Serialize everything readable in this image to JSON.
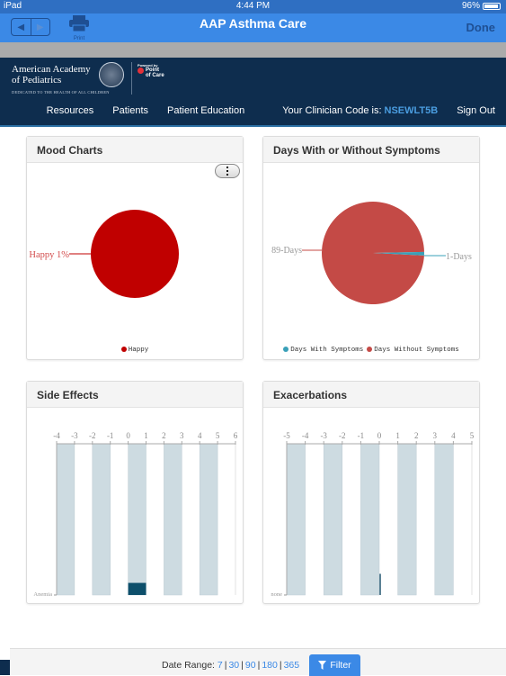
{
  "status_bar": {
    "device": "iPad",
    "time": "4:44 PM",
    "battery": "96%",
    "battery_level": 0.96
  },
  "nav_bar": {
    "title": "AAP Asthma Care",
    "print_label": "Print",
    "done_label": "Done"
  },
  "site_header": {
    "org_name_line1": "American Academy",
    "org_name_line2": "of Pediatrics",
    "tagline": "DEDICATED TO THE HEALTH OF ALL CHILDREN",
    "powered_by": "Powered by",
    "poc_line1": "Point",
    "poc_line2": "of Care",
    "nav": [
      {
        "label": "Resources"
      },
      {
        "label": "Patients"
      },
      {
        "label": "Patient Education"
      }
    ],
    "clinician_code_label": "Your Clinician Code is:",
    "clinician_code": "NSEWLT5B",
    "sign_out": "Sign Out"
  },
  "panels": {
    "mood": {
      "title": "Mood Charts"
    },
    "days": {
      "title": "Days With or Without Symptoms"
    },
    "side_effects": {
      "title": "Side Effects"
    },
    "exacerbations": {
      "title": "Exacerbations"
    }
  },
  "footer": {
    "date_range_label": "Date Range:",
    "ranges": [
      "7",
      "30",
      "90",
      "180",
      "365"
    ],
    "filter_label": "Filter"
  },
  "chart_data": [
    {
      "type": "pie",
      "title": "Mood Charts",
      "slices": [
        {
          "label": "Happy",
          "value": 100,
          "data_label": "Happy 1%",
          "color": "#c00000"
        }
      ],
      "legend": [
        "Happy"
      ],
      "legend_position": "bottom"
    },
    {
      "type": "pie",
      "title": "Days With or Without Symptoms",
      "slices": [
        {
          "label": "Days Without Symptoms",
          "value": 89,
          "data_label": "89-Days",
          "color": "#c44a46"
        },
        {
          "label": "Days With Symptoms",
          "value": 1,
          "data_label": "1-Days",
          "color": "#3aa0b8"
        }
      ],
      "legend": [
        "Days With Symptoms",
        "Days Without Symptoms"
      ],
      "legend_position": "bottom"
    },
    {
      "type": "bar",
      "title": "Side Effects",
      "x_ticks": [
        "-4",
        "-3",
        "-2",
        "-1",
        "0",
        "1",
        "2",
        "3",
        "4",
        "5",
        "6"
      ],
      "xlim": [
        -4,
        6
      ],
      "categories": [
        "Anemia"
      ],
      "band_stripes": [
        [
          -4,
          -3
        ],
        [
          -2,
          -1
        ],
        [
          0,
          1
        ],
        [
          2,
          3
        ],
        [
          4,
          5
        ]
      ],
      "series": [
        {
          "name": "Anemia",
          "x_start": 0,
          "x_end": 1,
          "value_fraction": 0.08,
          "color": "#0d4f6b"
        }
      ]
    },
    {
      "type": "bar",
      "title": "Exacerbations",
      "x_ticks": [
        "-5",
        "-4",
        "-3",
        "-2",
        "-1",
        "0",
        "1",
        "2",
        "3",
        "4",
        "5"
      ],
      "xlim": [
        -5,
        5
      ],
      "categories": [
        "none"
      ],
      "band_stripes": [
        [
          -5,
          -4
        ],
        [
          -3,
          -2
        ],
        [
          -1,
          0
        ],
        [
          1,
          2
        ],
        [
          3,
          4
        ]
      ],
      "series": [
        {
          "name": "none",
          "x_start": 0,
          "x_end": 0,
          "value_fraction": 0.14,
          "color": "#5a8194"
        }
      ]
    }
  ]
}
